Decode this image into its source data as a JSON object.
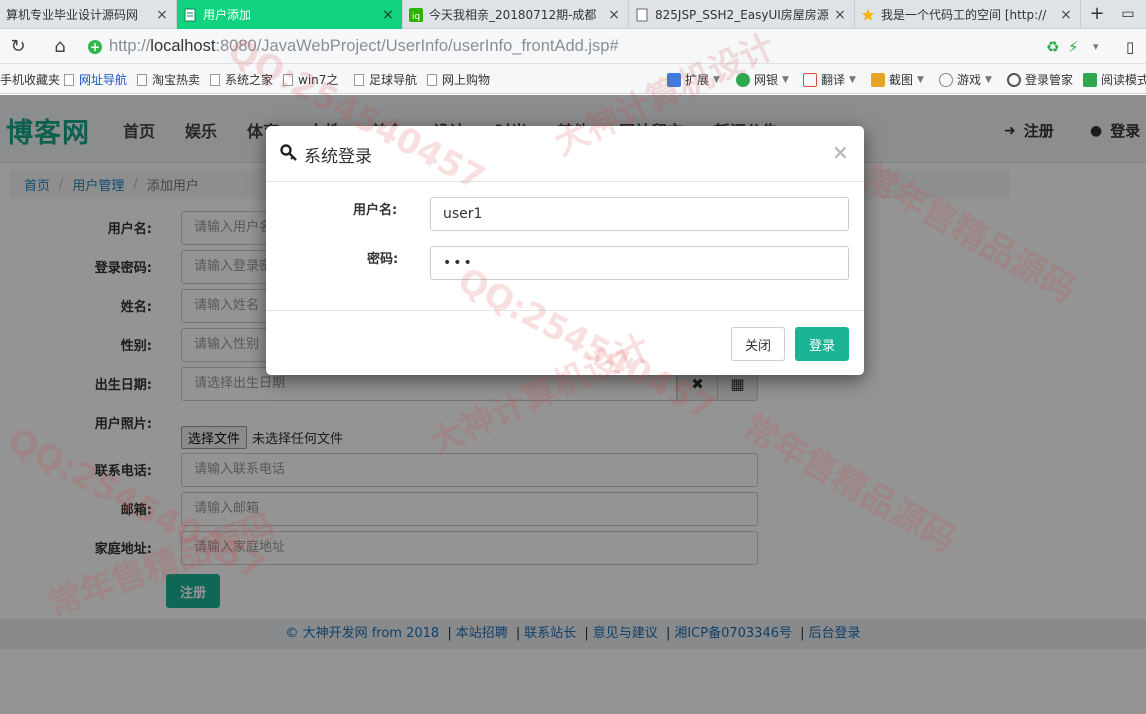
{
  "browser": {
    "tabs": [
      {
        "title": "算机专业毕业设计源码网",
        "active": false
      },
      {
        "title": "用户添加",
        "active": true
      },
      {
        "title": "今天我相亲_20180712期-成都",
        "active": false
      },
      {
        "title": "825JSP_SSH2_EasyUI房屋房源",
        "active": false
      },
      {
        "title": "我是一个代码工的空间 [http://",
        "active": false
      }
    ],
    "tab_close_glyph": "×",
    "new_tab_glyph": "+",
    "url_protocol": "http://",
    "url_host": "localhost",
    "url_rest": ":8080/JavaWebProject/UserInfo/userInfo_frontAdd.jsp#",
    "bookmarks": [
      "手机收藏夹",
      "网址导航",
      "淘宝热卖",
      "系统之家",
      "win7之",
      "足球导航",
      "网上购物"
    ],
    "toolbar": [
      "扩展",
      "网银",
      "翻译",
      "截图",
      "游戏",
      "登录管家",
      "阅读模式"
    ]
  },
  "site": {
    "brand": "博客网",
    "nav": [
      "首页",
      "娱乐",
      "体育",
      "女性",
      "美食",
      "设计",
      "时尚",
      "其他",
      "网站留言",
      "新闻公告"
    ],
    "register_label": "注册",
    "login_label": "登录",
    "breadcrumb": [
      "首页",
      "用户管理",
      "添加用户"
    ],
    "breadcrumb_sep": "/"
  },
  "form": {
    "fields": [
      {
        "label": "用户名:",
        "placeholder": "请输入用户名"
      },
      {
        "label": "登录密码:",
        "placeholder": "请输入登录密码"
      },
      {
        "label": "姓名:",
        "placeholder": "请输入姓名"
      },
      {
        "label": "性别:",
        "placeholder": "请输入性别"
      }
    ],
    "birthday": {
      "label": "出生日期:",
      "placeholder": "请选择出生日期"
    },
    "photo": {
      "label": "用户照片:",
      "button": "选择文件",
      "status": "未选择任何文件"
    },
    "fields2": [
      {
        "label": "联系电话:",
        "placeholder": "请输入联系电话"
      },
      {
        "label": "邮箱:",
        "placeholder": "请输入邮箱"
      },
      {
        "label": "家庭地址:",
        "placeholder": "请输入家庭地址"
      }
    ],
    "submit_label": "注册"
  },
  "footer": {
    "copyright": "© 大神开发网 from 2018",
    "links": [
      "本站招聘",
      "联系站长",
      "意见与建议",
      "湘ICP备0703346号",
      "后台登录"
    ]
  },
  "modal": {
    "title": "系统登录",
    "close_glyph": "×",
    "username_label": "用户名:",
    "username_value": "user1",
    "password_label": "密码:",
    "password_value": "•••",
    "close_button": "关闭",
    "login_button": "登录"
  },
  "watermark": [
    "QQ:254540457",
    "大神计算机设计",
    "常年售精品源码"
  ],
  "colors": {
    "accent": "#1ab394",
    "active_tab": "#11d27e",
    "link": "#1c84c6"
  }
}
